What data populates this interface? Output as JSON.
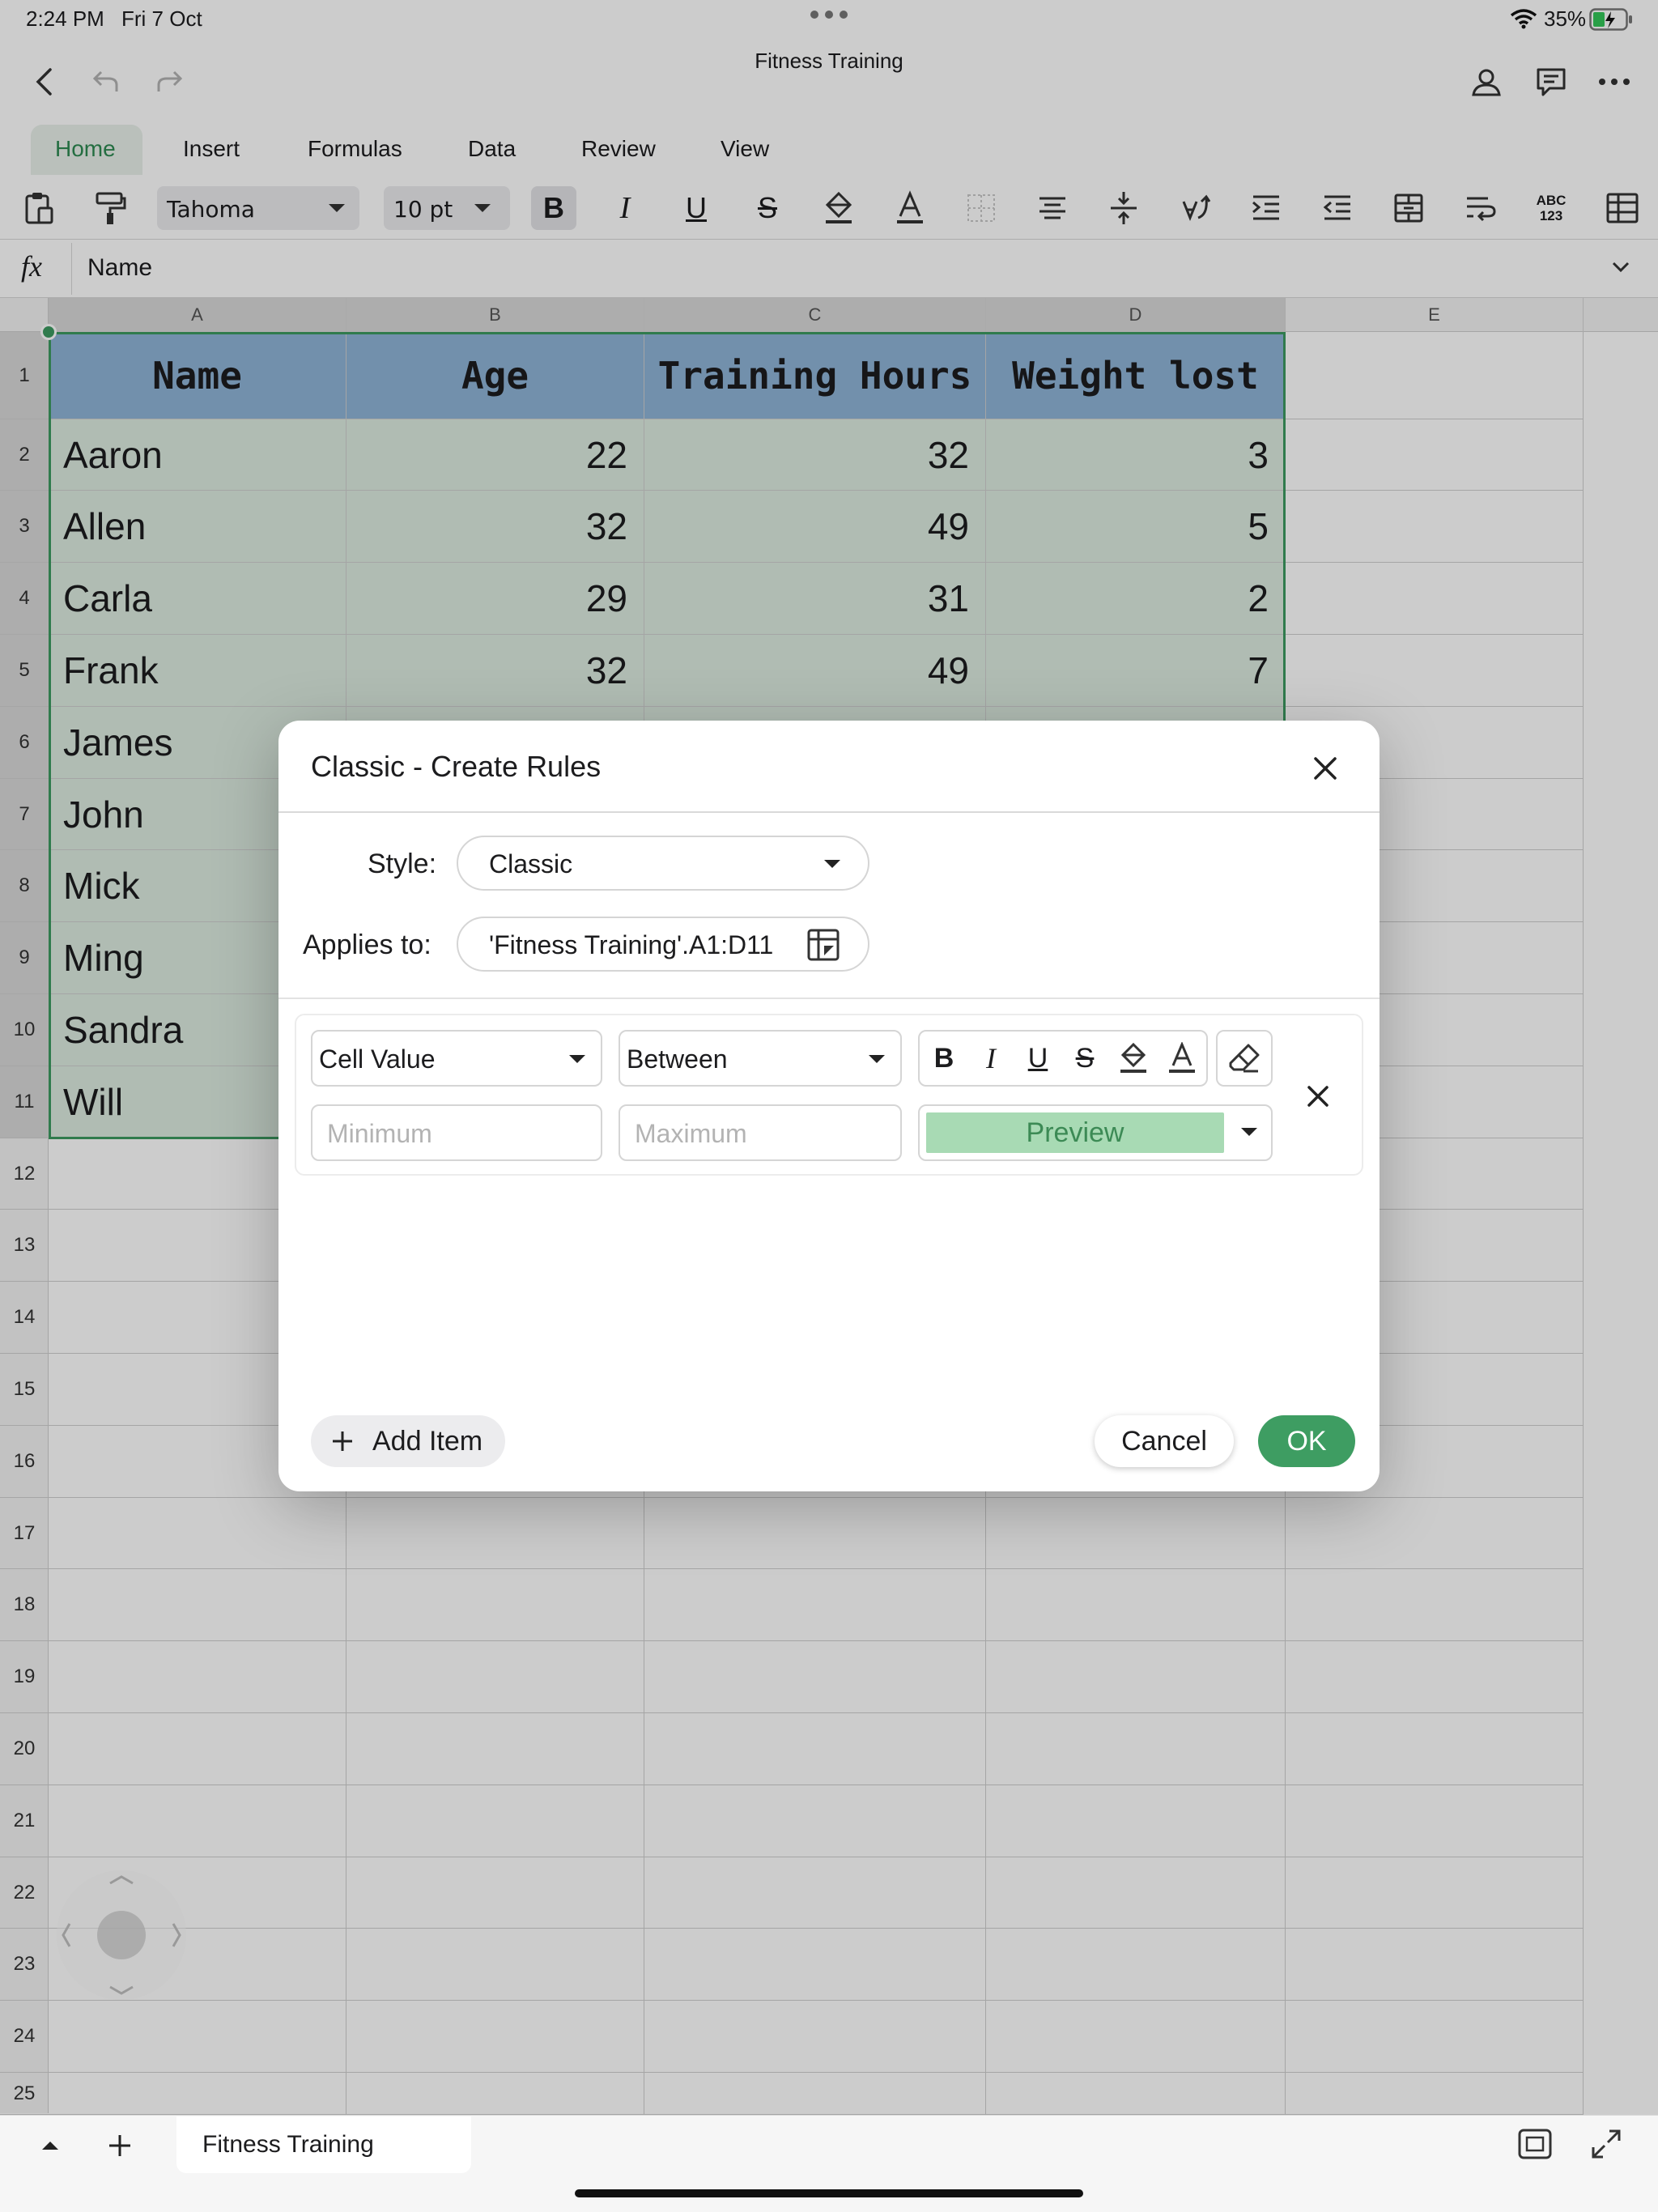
{
  "status": {
    "time": "2:24 PM",
    "date": "Fri 7 Oct",
    "battery": "35%"
  },
  "title_bar": {
    "title": "Fitness Training"
  },
  "ribbon": {
    "tabs": [
      "Home",
      "Insert",
      "Formulas",
      "Data",
      "Review",
      "View"
    ],
    "active_tab": "Home"
  },
  "toolbar": {
    "font": "Tahoma",
    "font_size": "10 pt",
    "convert_label_top": "ABC",
    "convert_label_bottom": "123"
  },
  "formula_bar": {
    "fx": "fx",
    "value": "Name"
  },
  "sheet": {
    "columns": [
      "A",
      "B",
      "C",
      "D",
      "E"
    ],
    "rows": [
      "1",
      "2",
      "3",
      "4",
      "5",
      "6",
      "7",
      "8",
      "9",
      "10",
      "11",
      "12",
      "13",
      "14",
      "15",
      "16",
      "17",
      "18",
      "19",
      "20",
      "21",
      "22",
      "23",
      "24",
      "25"
    ],
    "header": [
      "Name",
      "Age",
      "Training Hours",
      "Weight lost"
    ],
    "data": [
      [
        "Aaron",
        "22",
        "32",
        "3"
      ],
      [
        "Allen",
        "32",
        "49",
        "5"
      ],
      [
        "Carla",
        "29",
        "31",
        "2"
      ],
      [
        "Frank",
        "32",
        "49",
        "7"
      ],
      [
        "James",
        "",
        "",
        ""
      ],
      [
        "John",
        "",
        "",
        ""
      ],
      [
        "Mick",
        "",
        "",
        ""
      ],
      [
        "Ming",
        "",
        "",
        ""
      ],
      [
        "Sandra",
        "",
        "",
        ""
      ],
      [
        "Will",
        "",
        "",
        ""
      ]
    ],
    "colors": {
      "header_fill": "#8fb4d8",
      "body_fill": "#dcebe0",
      "selection": "#3d9a61"
    }
  },
  "dialog": {
    "title": "Classic - Create Rules",
    "style_label": "Style:",
    "style_value": "Classic",
    "applies_label": "Applies to:",
    "applies_value": "'Fitness Training'.A1:D11",
    "rule": {
      "condition_type": "Cell Value",
      "operator": "Between",
      "min_placeholder": "Minimum",
      "max_placeholder": "Maximum",
      "preview": "Preview",
      "format_buttons": [
        "B",
        "I",
        "U",
        "S"
      ]
    },
    "add_item": "Add Item",
    "cancel": "Cancel",
    "ok": "OK",
    "accent": "#3e9d62"
  },
  "bottom_bar": {
    "sheet_tab": "Fitness Training"
  }
}
